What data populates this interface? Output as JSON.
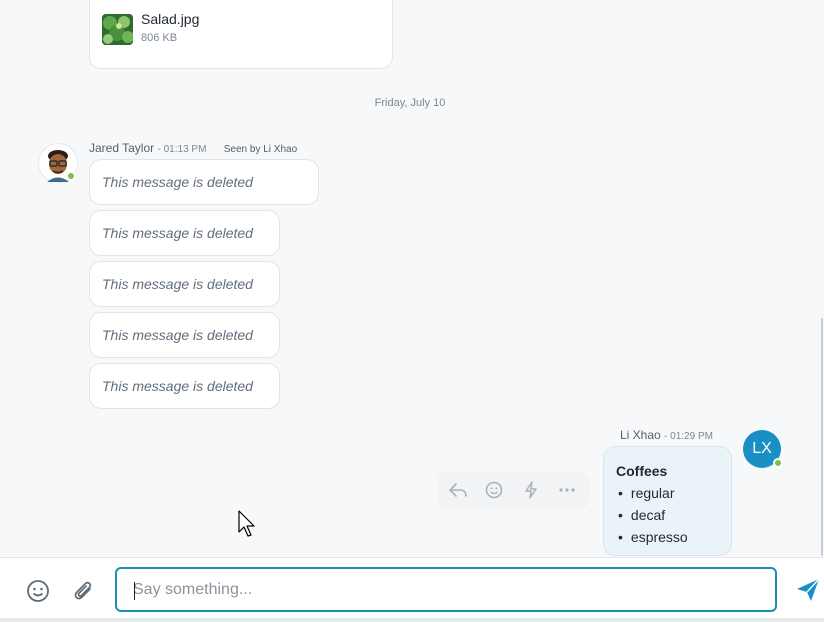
{
  "file": {
    "name": "Salad.jpg",
    "size": "806 KB",
    "thumb_icon": "image-thumbnail-icon"
  },
  "date_separator": "Friday, July 10",
  "messages_jared": {
    "sender": "Jared Taylor",
    "time": "- 01:13 PM",
    "seen": "Seen by Li Xhao",
    "deleted_text": "This message is deleted",
    "status_color": "#7cc242"
  },
  "messages_li": {
    "sender": "Li Xhao",
    "time": "- 01:29 PM",
    "avatar_initials": "LX",
    "avatar_color": "#1a8fc4",
    "title": "Coffees",
    "items": [
      "regular",
      "decaf",
      "espresso"
    ]
  },
  "actions": [
    "reply-icon",
    "emoji-icon",
    "flash-icon",
    "more-icon"
  ],
  "composer": {
    "placeholder": "Say something...",
    "accent": "#1a8fb0",
    "send_color": "#1a8fc4"
  }
}
